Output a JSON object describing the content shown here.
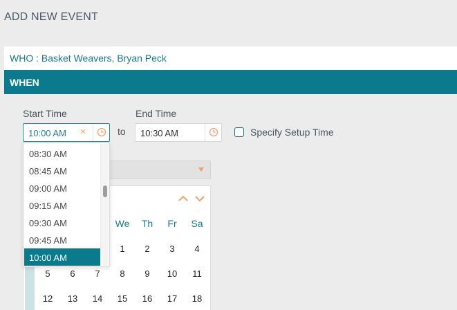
{
  "page": {
    "title": "ADD NEW EVENT"
  },
  "who": {
    "text": "WHO : Basket Weavers, Bryan Peck"
  },
  "when": {
    "title": "WHEN"
  },
  "start": {
    "label": "Start Time",
    "value": "10:00 AM",
    "clear_icon": "×"
  },
  "to_label": "to",
  "end": {
    "label": "End Time",
    "value": "10:30 AM"
  },
  "setup": {
    "label": "Specify Setup Time",
    "checked": false
  },
  "time_dropdown": {
    "items": [
      "08:30 AM",
      "08:45 AM",
      "09:00 AM",
      "09:15 AM",
      "09:30 AM",
      "09:45 AM",
      "10:00 AM"
    ],
    "selected": "10:00 AM"
  },
  "calendar": {
    "weekdays": [
      "We",
      "Th",
      "Fr",
      "Sa"
    ],
    "rows": [
      [
        "1",
        "2",
        "3",
        "4"
      ],
      [
        "5",
        "6",
        "7",
        "8",
        "9",
        "10",
        "11"
      ],
      [
        "12",
        "13",
        "14",
        "15",
        "16",
        "17",
        "18"
      ]
    ]
  },
  "colors": {
    "accent": "#0a7a8c",
    "icon": "#f0a070",
    "link": "#187a8c"
  }
}
